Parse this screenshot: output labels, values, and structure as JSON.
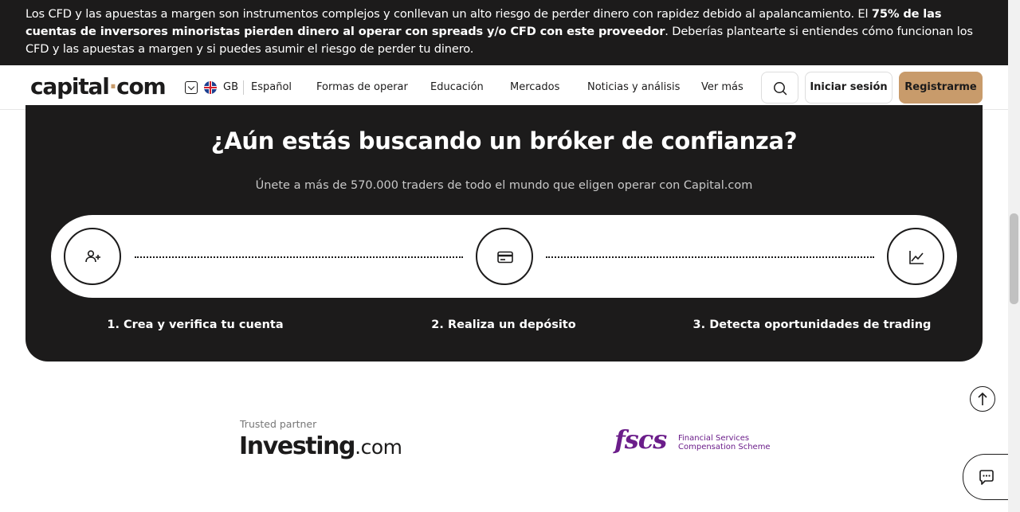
{
  "risk_banner": {
    "text_start": "Los CFD y las apuestas a margen son instrumentos complejos y conllevan un alto riesgo de perder dinero con rapidez debido al apalancamiento. El ",
    "text_bold": "75% de las cuentas de inversores minoristas pierden dinero al operar con spreads y/o CFD con este proveedor",
    "text_end": ". Deberías plantearte si entiendes cómo funcionan los CFD y las apuestas a margen y si puedes asumir el riesgo de perder tu dinero."
  },
  "header": {
    "logo_left": "capital",
    "logo_dot": "·",
    "logo_right": "com",
    "region_code": "GB",
    "language": "Español",
    "nav": [
      "Formas de operar",
      "Educación",
      "Mercados",
      "Noticias y análisis",
      "Ver más"
    ],
    "login_label": "Iniciar sesión",
    "register_label": "Registrarme"
  },
  "promo": {
    "title": "¿Aún estás buscando un bróker de confianza?",
    "subtitle": "Únete a más de 570.000 traders de todo el mundo que eligen operar con Capital.com",
    "steps": [
      {
        "label": "1. Crea y verifica tu cuenta",
        "icon": "user-plus-icon"
      },
      {
        "label": "2. Realiza un depósito",
        "icon": "credit-card-icon"
      },
      {
        "label": "3. Detecta oportunidades de trading",
        "icon": "chart-line-icon"
      }
    ]
  },
  "partners": {
    "trusted_label": "Trusted partner",
    "investing_main": "Investing",
    "investing_suffix": ".com",
    "fscs_mark": "fscs",
    "fscs_line1": "Financial Services",
    "fscs_line2": "Compensation Scheme"
  },
  "colors": {
    "dark": "#1c1b1b",
    "accent": "#c89b6b",
    "fscs_purple": "#6b1d8a"
  }
}
